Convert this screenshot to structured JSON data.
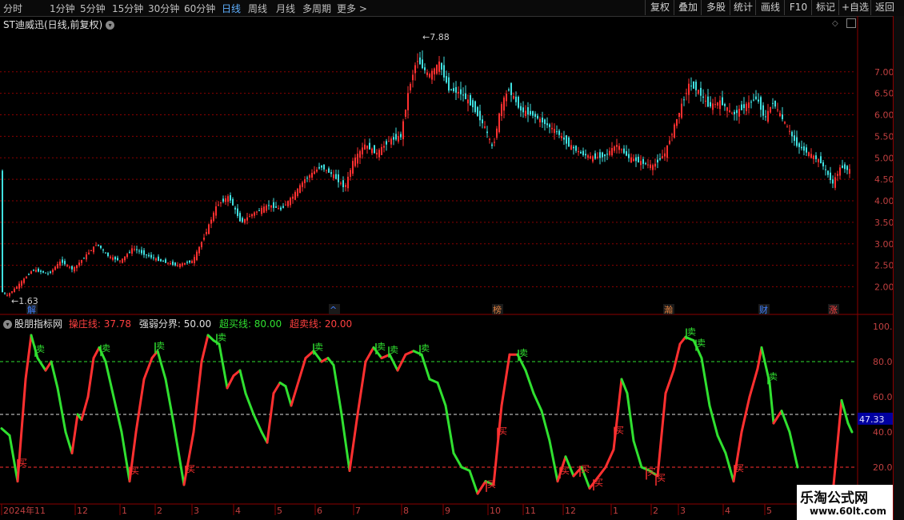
{
  "toolbar": {
    "timeframes": [
      "分时",
      "1分钟",
      "5分钟",
      "15分钟",
      "30分钟",
      "60分钟",
      "日线",
      "周线",
      "月线",
      "多周期",
      "更多 >"
    ],
    "active_index": 6,
    "buttons": [
      "复权",
      "叠加",
      "多股",
      "统计",
      "画线",
      "F10",
      "标记",
      "+自选",
      "返回"
    ]
  },
  "main_title": "ST迪威迅(日线,前复权)",
  "indicator": {
    "name": "股朋指标网",
    "line1_label": "操庄线: 37.78",
    "line2_label": "强弱分界: 50.00",
    "line3_label": "超买线: 80.00",
    "line4_label": "超卖线: 20.00"
  },
  "colors": {
    "up": "#ff3030",
    "down": "#40e0e0",
    "buy": "#ff3030",
    "sell": "#30e030",
    "grid": "#8b0000",
    "axis": "#c04040",
    "hl": "#0000a0"
  },
  "price_axis_labels": [
    "7.00",
    "6.50",
    "6.00",
    "5.50",
    "5.00",
    "4.50",
    "4.00",
    "3.50",
    "3.00",
    "2.50",
    "2.00"
  ],
  "ind_axis_labels": [
    "100.0",
    "80.00",
    "60.00",
    "40.00",
    "20.00"
  ],
  "last_value": "47.33",
  "date_labels": [
    "2024年11",
    "12",
    "1",
    "2",
    "3",
    "4",
    "5",
    "6",
    "7",
    "8",
    "9",
    "10",
    "11",
    "12",
    "1",
    "2",
    "3",
    "4",
    "5"
  ],
  "event_markers": [
    "解",
    "^",
    "榜",
    "瀚",
    "财",
    "涨"
  ],
  "high_label": "7.88",
  "low_label": "1.63",
  "buy_glyph": "买",
  "sell_glyph": "卖",
  "watermark": {
    "title": "乐淘公式网",
    "url": "www.60lt.com"
  },
  "chart_data": [
    {
      "type": "candlestick",
      "title": "ST迪威迅(日线,前复权)",
      "ylim": [
        1.6,
        8.0
      ],
      "price_waypoints": [
        [
          0,
          1.9
        ],
        [
          8,
          1.8
        ],
        [
          20,
          2.0
        ],
        [
          40,
          2.4
        ],
        [
          60,
          2.3
        ],
        [
          75,
          2.6
        ],
        [
          90,
          2.4
        ],
        [
          105,
          2.7
        ],
        [
          120,
          3.0
        ],
        [
          135,
          2.7
        ],
        [
          150,
          2.6
        ],
        [
          165,
          2.9
        ],
        [
          180,
          2.75
        ],
        [
          200,
          2.6
        ],
        [
          220,
          2.5
        ],
        [
          240,
          2.6
        ],
        [
          255,
          3.2
        ],
        [
          270,
          3.9
        ],
        [
          285,
          4.1
        ],
        [
          300,
          3.5
        ],
        [
          315,
          3.7
        ],
        [
          335,
          3.9
        ],
        [
          350,
          3.8
        ],
        [
          365,
          4.1
        ],
        [
          380,
          4.5
        ],
        [
          400,
          4.8
        ],
        [
          415,
          4.6
        ],
        [
          430,
          4.3
        ],
        [
          440,
          4.9
        ],
        [
          455,
          5.3
        ],
        [
          470,
          5.1
        ],
        [
          485,
          5.4
        ],
        [
          500,
          5.5
        ],
        [
          510,
          6.6
        ],
        [
          520,
          7.3
        ],
        [
          535,
          6.9
        ],
        [
          548,
          7.2
        ],
        [
          560,
          6.6
        ],
        [
          575,
          6.5
        ],
        [
          590,
          6.2
        ],
        [
          605,
          5.7
        ],
        [
          615,
          5.2
        ],
        [
          625,
          6.2
        ],
        [
          635,
          6.6
        ],
        [
          650,
          6.1
        ],
        [
          665,
          6.0
        ],
        [
          680,
          5.8
        ],
        [
          695,
          5.6
        ],
        [
          710,
          5.3
        ],
        [
          725,
          5.1
        ],
        [
          740,
          5.0
        ],
        [
          755,
          5.05
        ],
        [
          770,
          5.3
        ],
        [
          785,
          5.0
        ],
        [
          800,
          4.9
        ],
        [
          815,
          4.8
        ],
        [
          830,
          5.1
        ],
        [
          845,
          5.9
        ],
        [
          860,
          6.7
        ],
        [
          870,
          6.6
        ],
        [
          885,
          6.2
        ],
        [
          900,
          6.3
        ],
        [
          915,
          6.0
        ],
        [
          930,
          6.2
        ],
        [
          945,
          6.4
        ],
        [
          955,
          5.9
        ],
        [
          965,
          6.3
        ],
        [
          980,
          5.8
        ],
        [
          995,
          5.3
        ],
        [
          1010,
          5.1
        ],
        [
          1025,
          4.9
        ],
        [
          1040,
          4.4
        ],
        [
          1050,
          4.8
        ],
        [
          1062,
          4.7
        ]
      ],
      "high_label": "7.88",
      "low_label": "1.63"
    },
    {
      "type": "line",
      "series": [
        {
          "name": "操庄线"
        }
      ],
      "ylim": [
        0,
        105
      ],
      "reference_lines": [
        {
          "value": 80,
          "color": "#30e030",
          "name": "超买线"
        },
        {
          "value": 50,
          "color": "#e0e0e0",
          "name": "强弱分界"
        },
        {
          "value": 20,
          "color": "#ff3030",
          "name": "超卖线"
        }
      ],
      "x_pixel_scale_note": "index-in-px",
      "points": [
        [
          0,
          42
        ],
        [
          10,
          38
        ],
        [
          20,
          12
        ],
        [
          30,
          70
        ],
        [
          37,
          95
        ],
        [
          45,
          82
        ],
        [
          55,
          75
        ],
        [
          62,
          80
        ],
        [
          70,
          65
        ],
        [
          80,
          40
        ],
        [
          88,
          28
        ],
        [
          95,
          50
        ],
        [
          100,
          47
        ],
        [
          108,
          60
        ],
        [
          115,
          82
        ],
        [
          122,
          88
        ],
        [
          130,
          80
        ],
        [
          140,
          60
        ],
        [
          150,
          40
        ],
        [
          160,
          12
        ],
        [
          168,
          40
        ],
        [
          178,
          70
        ],
        [
          188,
          82
        ],
        [
          195,
          86
        ],
        [
          205,
          70
        ],
        [
          215,
          45
        ],
        [
          228,
          10
        ],
        [
          240,
          40
        ],
        [
          250,
          80
        ],
        [
          258,
          95
        ],
        [
          265,
          92
        ],
        [
          272,
          90
        ],
        [
          282,
          65
        ],
        [
          290,
          72
        ],
        [
          298,
          75
        ],
        [
          305,
          62
        ],
        [
          315,
          50
        ],
        [
          325,
          40
        ],
        [
          332,
          34
        ],
        [
          340,
          62
        ],
        [
          348,
          68
        ],
        [
          355,
          66
        ],
        [
          362,
          55
        ],
        [
          372,
          70
        ],
        [
          380,
          82
        ],
        [
          390,
          86
        ],
        [
          400,
          80
        ],
        [
          408,
          82
        ],
        [
          415,
          78
        ],
        [
          425,
          50
        ],
        [
          435,
          18
        ],
        [
          445,
          50
        ],
        [
          455,
          80
        ],
        [
          465,
          88
        ],
        [
          475,
          82
        ],
        [
          485,
          84
        ],
        [
          495,
          75
        ],
        [
          505,
          84
        ],
        [
          515,
          86
        ],
        [
          525,
          84
        ],
        [
          535,
          70
        ],
        [
          545,
          68
        ],
        [
          555,
          55
        ],
        [
          565,
          28
        ],
        [
          575,
          20
        ],
        [
          585,
          18
        ],
        [
          595,
          5
        ],
        [
          605,
          12
        ],
        [
          615,
          10
        ],
        [
          625,
          55
        ],
        [
          635,
          84
        ],
        [
          645,
          84
        ],
        [
          655,
          75
        ],
        [
          665,
          62
        ],
        [
          675,
          52
        ],
        [
          685,
          35
        ],
        [
          695,
          12
        ],
        [
          705,
          26
        ],
        [
          715,
          15
        ],
        [
          725,
          20
        ],
        [
          735,
          8
        ],
        [
          745,
          14
        ],
        [
          755,
          20
        ],
        [
          765,
          30
        ],
        [
          775,
          70
        ],
        [
          782,
          62
        ],
        [
          790,
          35
        ],
        [
          800,
          20
        ],
        [
          810,
          18
        ],
        [
          820,
          15
        ],
        [
          830,
          62
        ],
        [
          840,
          75
        ],
        [
          848,
          90
        ],
        [
          855,
          94
        ],
        [
          865,
          92
        ],
        [
          875,
          82
        ],
        [
          885,
          55
        ],
        [
          895,
          38
        ],
        [
          905,
          28
        ],
        [
          915,
          12
        ],
        [
          925,
          40
        ],
        [
          935,
          60
        ],
        [
          945,
          76
        ],
        [
          950,
          88
        ],
        [
          960,
          68
        ],
        [
          965,
          45
        ],
        [
          975,
          52
        ],
        [
          985,
          40
        ],
        [
          995,
          20
        ],
        [
          1000,
          10
        ],
        [
          1040,
          10
        ],
        [
          1050,
          58
        ],
        [
          1058,
          45
        ],
        [
          1063,
          40
        ]
      ],
      "buy_x": [
        22,
        162,
        232,
        608,
        622,
        700,
        725,
        742,
        768,
        808,
        820,
        918
      ],
      "sell_x": [
        44,
        126,
        194,
        271,
        392,
        470,
        486,
        525,
        648,
        858,
        870,
        960
      ],
      "last_value": 47.33
    }
  ]
}
